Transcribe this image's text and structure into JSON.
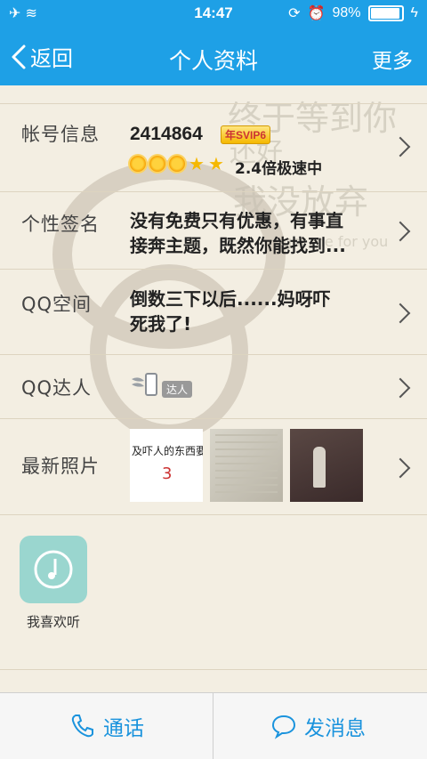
{
  "status": {
    "time": "14:47",
    "battery": "98%",
    "battery_level": 0.98
  },
  "nav": {
    "back_label": "返回",
    "title": "个人资料",
    "more_label": "更多"
  },
  "background": {
    "watermark_lines": [
      "终于等到你",
      "还好",
      "我没放弃"
    ],
    "watermark_small": "got me for you"
  },
  "rows": {
    "account": {
      "label": "帐号信息",
      "number": "2414864",
      "badge": "年SVIP6",
      "speed": "2.4倍极速中",
      "level_icons": [
        "sun-icon",
        "sun-icon",
        "sun-icon",
        "star-icon",
        "star-icon"
      ]
    },
    "signature": {
      "label": "个性签名",
      "line1": "没有免费只有优惠，有事直",
      "line2": "接奔主题，既然你能找到..."
    },
    "qzone": {
      "label": "QQ空间",
      "line1": "倒数三下以后......妈呀吓",
      "line2": "死我了!"
    },
    "talent": {
      "label": "QQ达人",
      "badge": "达人"
    },
    "photos": {
      "label": "最新照片",
      "photo1_text": "及吓人的东西要",
      "photo1_num": "3"
    }
  },
  "music": {
    "label": "我喜欢听"
  },
  "bottom": {
    "call_label": "通话",
    "message_label": "发消息"
  },
  "colors": {
    "accent": "#1ea0e6",
    "bottom_text": "#1a93dd",
    "background": "#f3eee2"
  }
}
